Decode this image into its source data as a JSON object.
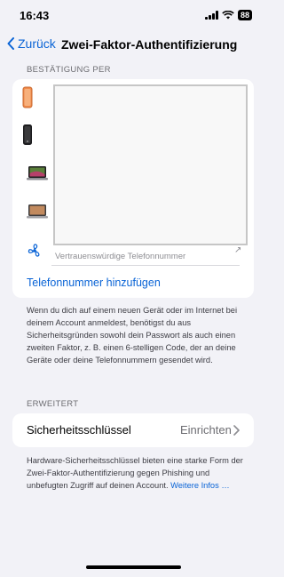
{
  "status_bar": {
    "time": "16:43",
    "battery": "88"
  },
  "nav": {
    "back_label": "Zurück",
    "title": "Zwei-Faktor-Authentifizierung"
  },
  "confirmation": {
    "header": "BESTÄTIGUNG PER",
    "devices": [
      {
        "icon": "iphone-orange-icon"
      },
      {
        "icon": "iphone-black-icon"
      },
      {
        "icon": "macbook-icon"
      },
      {
        "icon": "macbook-gray-icon"
      },
      {
        "icon": "fan-icon"
      }
    ],
    "trusted_label": "Vertrauenswürdige Telefonnummer",
    "add_phone": "Telefonnummer hinzufügen",
    "footnote": "Wenn du dich auf einem neuen Gerät oder im Internet bei deinem Account anmeldest, benötigst du aus Sicherheitsgründen sowohl dein Passwort als auch einen zweiten Faktor, z. B. einen 6-stelligen Code, der an deine Geräte oder deine Telefonnummern gesendet wird."
  },
  "advanced": {
    "header": "ERWEITERT",
    "security_key_label": "Sicherheitsschlüssel",
    "security_key_value": "Einrichten",
    "footnote": "Hardware-Sicherheitsschlüssel bieten eine starke Form der Zwei-Faktor-Authentifizierung gegen Phishing und unbefugten Zugriff auf deinen Account.",
    "more_link": "Weitere Infos …"
  },
  "colors": {
    "accent": "#0a64d6",
    "background": "#f2f2f7"
  }
}
